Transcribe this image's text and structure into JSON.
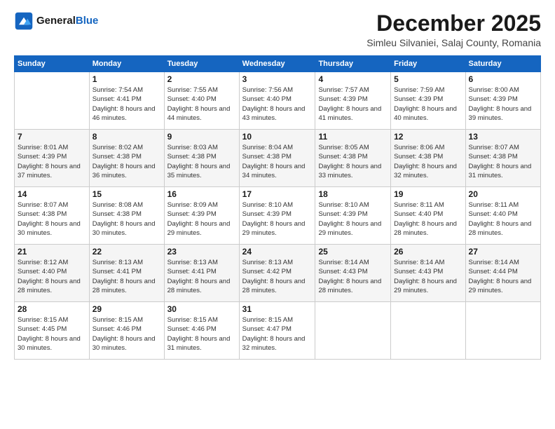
{
  "header": {
    "logo_general": "General",
    "logo_blue": "Blue",
    "month_title": "December 2025",
    "location": "Simleu Silvaniei, Salaj County, Romania"
  },
  "weekdays": [
    "Sunday",
    "Monday",
    "Tuesday",
    "Wednesday",
    "Thursday",
    "Friday",
    "Saturday"
  ],
  "weeks": [
    [
      {
        "day": "",
        "sunrise": "",
        "sunset": "",
        "daylight": ""
      },
      {
        "day": "1",
        "sunrise": "Sunrise: 7:54 AM",
        "sunset": "Sunset: 4:41 PM",
        "daylight": "Daylight: 8 hours and 46 minutes."
      },
      {
        "day": "2",
        "sunrise": "Sunrise: 7:55 AM",
        "sunset": "Sunset: 4:40 PM",
        "daylight": "Daylight: 8 hours and 44 minutes."
      },
      {
        "day": "3",
        "sunrise": "Sunrise: 7:56 AM",
        "sunset": "Sunset: 4:40 PM",
        "daylight": "Daylight: 8 hours and 43 minutes."
      },
      {
        "day": "4",
        "sunrise": "Sunrise: 7:57 AM",
        "sunset": "Sunset: 4:39 PM",
        "daylight": "Daylight: 8 hours and 41 minutes."
      },
      {
        "day": "5",
        "sunrise": "Sunrise: 7:59 AM",
        "sunset": "Sunset: 4:39 PM",
        "daylight": "Daylight: 8 hours and 40 minutes."
      },
      {
        "day": "6",
        "sunrise": "Sunrise: 8:00 AM",
        "sunset": "Sunset: 4:39 PM",
        "daylight": "Daylight: 8 hours and 39 minutes."
      }
    ],
    [
      {
        "day": "7",
        "sunrise": "Sunrise: 8:01 AM",
        "sunset": "Sunset: 4:39 PM",
        "daylight": "Daylight: 8 hours and 37 minutes."
      },
      {
        "day": "8",
        "sunrise": "Sunrise: 8:02 AM",
        "sunset": "Sunset: 4:38 PM",
        "daylight": "Daylight: 8 hours and 36 minutes."
      },
      {
        "day": "9",
        "sunrise": "Sunrise: 8:03 AM",
        "sunset": "Sunset: 4:38 PM",
        "daylight": "Daylight: 8 hours and 35 minutes."
      },
      {
        "day": "10",
        "sunrise": "Sunrise: 8:04 AM",
        "sunset": "Sunset: 4:38 PM",
        "daylight": "Daylight: 8 hours and 34 minutes."
      },
      {
        "day": "11",
        "sunrise": "Sunrise: 8:05 AM",
        "sunset": "Sunset: 4:38 PM",
        "daylight": "Daylight: 8 hours and 33 minutes."
      },
      {
        "day": "12",
        "sunrise": "Sunrise: 8:06 AM",
        "sunset": "Sunset: 4:38 PM",
        "daylight": "Daylight: 8 hours and 32 minutes."
      },
      {
        "day": "13",
        "sunrise": "Sunrise: 8:07 AM",
        "sunset": "Sunset: 4:38 PM",
        "daylight": "Daylight: 8 hours and 31 minutes."
      }
    ],
    [
      {
        "day": "14",
        "sunrise": "Sunrise: 8:07 AM",
        "sunset": "Sunset: 4:38 PM",
        "daylight": "Daylight: 8 hours and 30 minutes."
      },
      {
        "day": "15",
        "sunrise": "Sunrise: 8:08 AM",
        "sunset": "Sunset: 4:38 PM",
        "daylight": "Daylight: 8 hours and 30 minutes."
      },
      {
        "day": "16",
        "sunrise": "Sunrise: 8:09 AM",
        "sunset": "Sunset: 4:39 PM",
        "daylight": "Daylight: 8 hours and 29 minutes."
      },
      {
        "day": "17",
        "sunrise": "Sunrise: 8:10 AM",
        "sunset": "Sunset: 4:39 PM",
        "daylight": "Daylight: 8 hours and 29 minutes."
      },
      {
        "day": "18",
        "sunrise": "Sunrise: 8:10 AM",
        "sunset": "Sunset: 4:39 PM",
        "daylight": "Daylight: 8 hours and 29 minutes."
      },
      {
        "day": "19",
        "sunrise": "Sunrise: 8:11 AM",
        "sunset": "Sunset: 4:40 PM",
        "daylight": "Daylight: 8 hours and 28 minutes."
      },
      {
        "day": "20",
        "sunrise": "Sunrise: 8:11 AM",
        "sunset": "Sunset: 4:40 PM",
        "daylight": "Daylight: 8 hours and 28 minutes."
      }
    ],
    [
      {
        "day": "21",
        "sunrise": "Sunrise: 8:12 AM",
        "sunset": "Sunset: 4:40 PM",
        "daylight": "Daylight: 8 hours and 28 minutes."
      },
      {
        "day": "22",
        "sunrise": "Sunrise: 8:13 AM",
        "sunset": "Sunset: 4:41 PM",
        "daylight": "Daylight: 8 hours and 28 minutes."
      },
      {
        "day": "23",
        "sunrise": "Sunrise: 8:13 AM",
        "sunset": "Sunset: 4:41 PM",
        "daylight": "Daylight: 8 hours and 28 minutes."
      },
      {
        "day": "24",
        "sunrise": "Sunrise: 8:13 AM",
        "sunset": "Sunset: 4:42 PM",
        "daylight": "Daylight: 8 hours and 28 minutes."
      },
      {
        "day": "25",
        "sunrise": "Sunrise: 8:14 AM",
        "sunset": "Sunset: 4:43 PM",
        "daylight": "Daylight: 8 hours and 28 minutes."
      },
      {
        "day": "26",
        "sunrise": "Sunrise: 8:14 AM",
        "sunset": "Sunset: 4:43 PM",
        "daylight": "Daylight: 8 hours and 29 minutes."
      },
      {
        "day": "27",
        "sunrise": "Sunrise: 8:14 AM",
        "sunset": "Sunset: 4:44 PM",
        "daylight": "Daylight: 8 hours and 29 minutes."
      }
    ],
    [
      {
        "day": "28",
        "sunrise": "Sunrise: 8:15 AM",
        "sunset": "Sunset: 4:45 PM",
        "daylight": "Daylight: 8 hours and 30 minutes."
      },
      {
        "day": "29",
        "sunrise": "Sunrise: 8:15 AM",
        "sunset": "Sunset: 4:46 PM",
        "daylight": "Daylight: 8 hours and 30 minutes."
      },
      {
        "day": "30",
        "sunrise": "Sunrise: 8:15 AM",
        "sunset": "Sunset: 4:46 PM",
        "daylight": "Daylight: 8 hours and 31 minutes."
      },
      {
        "day": "31",
        "sunrise": "Sunrise: 8:15 AM",
        "sunset": "Sunset: 4:47 PM",
        "daylight": "Daylight: 8 hours and 32 minutes."
      },
      {
        "day": "",
        "sunrise": "",
        "sunset": "",
        "daylight": ""
      },
      {
        "day": "",
        "sunrise": "",
        "sunset": "",
        "daylight": ""
      },
      {
        "day": "",
        "sunrise": "",
        "sunset": "",
        "daylight": ""
      }
    ]
  ]
}
